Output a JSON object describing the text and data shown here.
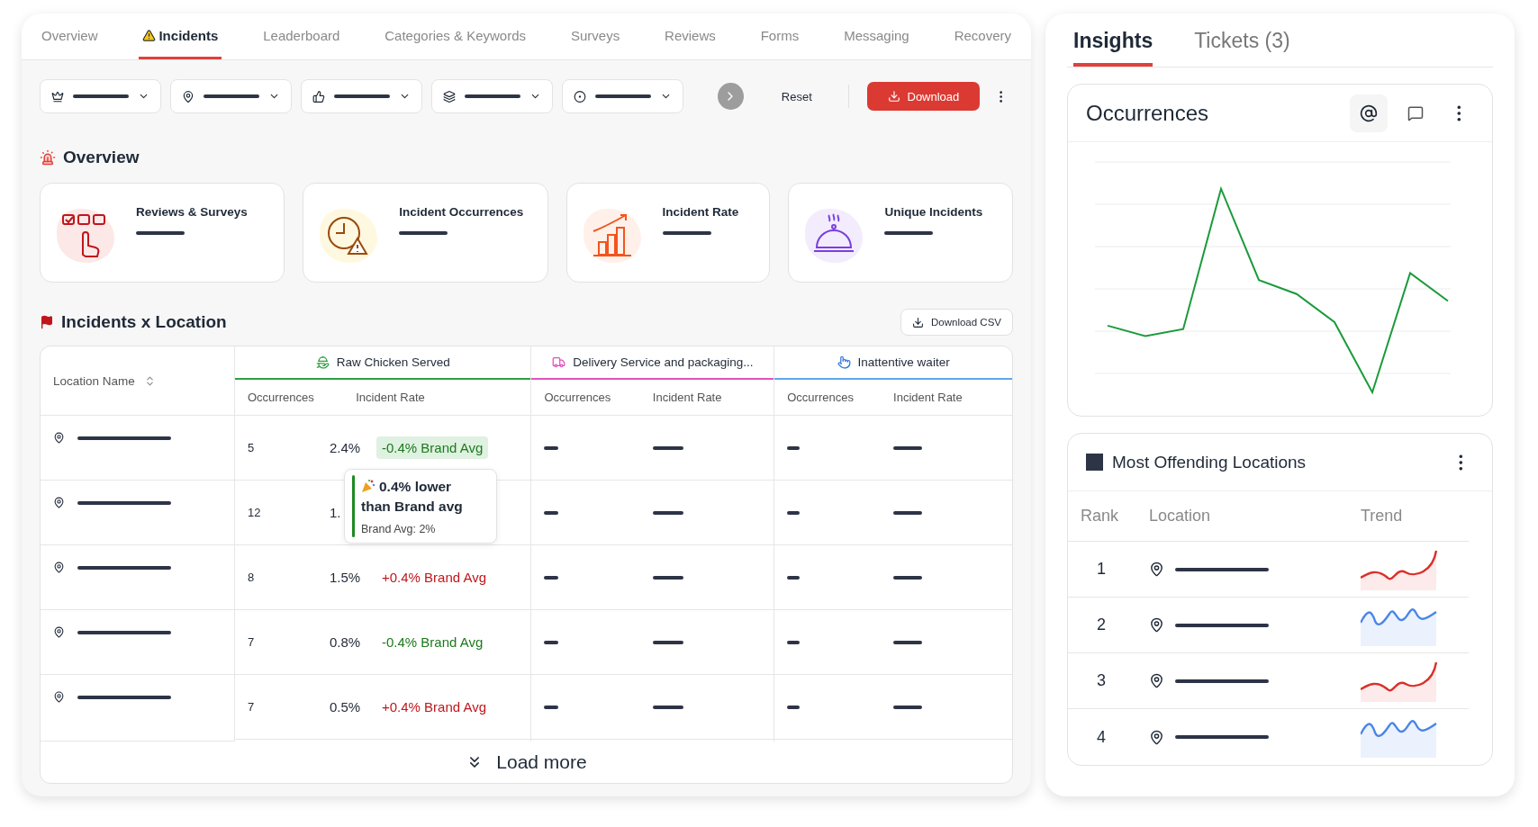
{
  "tabs": [
    {
      "label": "Overview",
      "selected": false,
      "warning": false
    },
    {
      "label": "Incidents",
      "selected": true,
      "warning": true
    },
    {
      "label": "Leaderboard",
      "selected": false,
      "warning": false
    },
    {
      "label": "Categories & Keywords",
      "selected": false,
      "warning": false
    },
    {
      "label": "Surveys",
      "selected": false,
      "warning": false
    },
    {
      "label": "Reviews",
      "selected": false,
      "warning": false
    },
    {
      "label": "Forms",
      "selected": false,
      "warning": false
    },
    {
      "label": "Messaging",
      "selected": false,
      "warning": false
    },
    {
      "label": "Recovery",
      "selected": false,
      "warning": false
    }
  ],
  "filters": [
    {
      "kind": "brand"
    },
    {
      "kind": "location"
    },
    {
      "kind": "feedback"
    },
    {
      "kind": "layers"
    },
    {
      "kind": "target"
    }
  ],
  "toolbar": {
    "reset": "Reset",
    "download": "Download"
  },
  "overview": {
    "title": "Overview",
    "cards": [
      {
        "kind": "surveys",
        "label": "Reviews & Surveys"
      },
      {
        "kind": "occurrences",
        "label": "Incident Occurrences"
      },
      {
        "kind": "rate",
        "label": "Incident Rate"
      },
      {
        "kind": "unique",
        "label": "Unique Incidents"
      }
    ]
  },
  "incidents_table": {
    "title": "Incidents x Location",
    "download_csv": "Download CSV",
    "location_header": "Location Name",
    "groups": [
      {
        "kind": "food",
        "label": "Raw Chicken Served",
        "color": "#2ea043",
        "subcolumns": [
          "Occurrences",
          "Incident Rate"
        ]
      },
      {
        "kind": "delivery",
        "label": "Delivery Service and packaging...",
        "color": "#e052b8",
        "subcolumns": [
          "Occurrences",
          "Incident Rate"
        ]
      },
      {
        "kind": "waiter",
        "label": "Inattentive waiter",
        "color": "#5ea8e8",
        "subcolumns": [
          "Occurrences",
          "Incident Rate"
        ]
      }
    ],
    "rows": [
      {
        "occurrences": "5",
        "rate": "2.4%",
        "delta": {
          "text": "-0.4% Brand Avg",
          "kind": "lower",
          "highlighted": true
        }
      },
      {
        "occurrences": "12",
        "rate": "1."
      },
      {
        "occurrences": "8",
        "rate": "1.5%",
        "delta": {
          "text": "+0.4% Brand Avg",
          "kind": "higher",
          "highlighted": false
        }
      },
      {
        "occurrences": "7",
        "rate": "0.8%",
        "delta": {
          "text": "-0.4% Brand Avg",
          "kind": "lower",
          "highlighted": false
        }
      },
      {
        "occurrences": "7",
        "rate": "0.5%",
        "delta": {
          "text": "+0.4% Brand Avg",
          "kind": "higher",
          "highlighted": false
        }
      }
    ],
    "tooltip": {
      "title": "0.4% lower than Brand avg",
      "detail": "Brand Avg: 2%"
    },
    "load_more": "Load more"
  },
  "side_tabs": [
    {
      "label": "Insights",
      "selected": true
    },
    {
      "label": "Tickets (3)",
      "selected": false
    }
  ],
  "occurrences_card": {
    "title": "Occurrences"
  },
  "offending_locations": {
    "title": "Most Offending Locations",
    "columns": [
      "Rank",
      "Location",
      "Trend"
    ],
    "rows": [
      {
        "rank": "1",
        "kind": "rising"
      },
      {
        "rank": "2",
        "kind": "wavy"
      },
      {
        "rank": "3",
        "kind": "rising"
      },
      {
        "rank": "4",
        "kind": "wavy"
      }
    ]
  }
}
